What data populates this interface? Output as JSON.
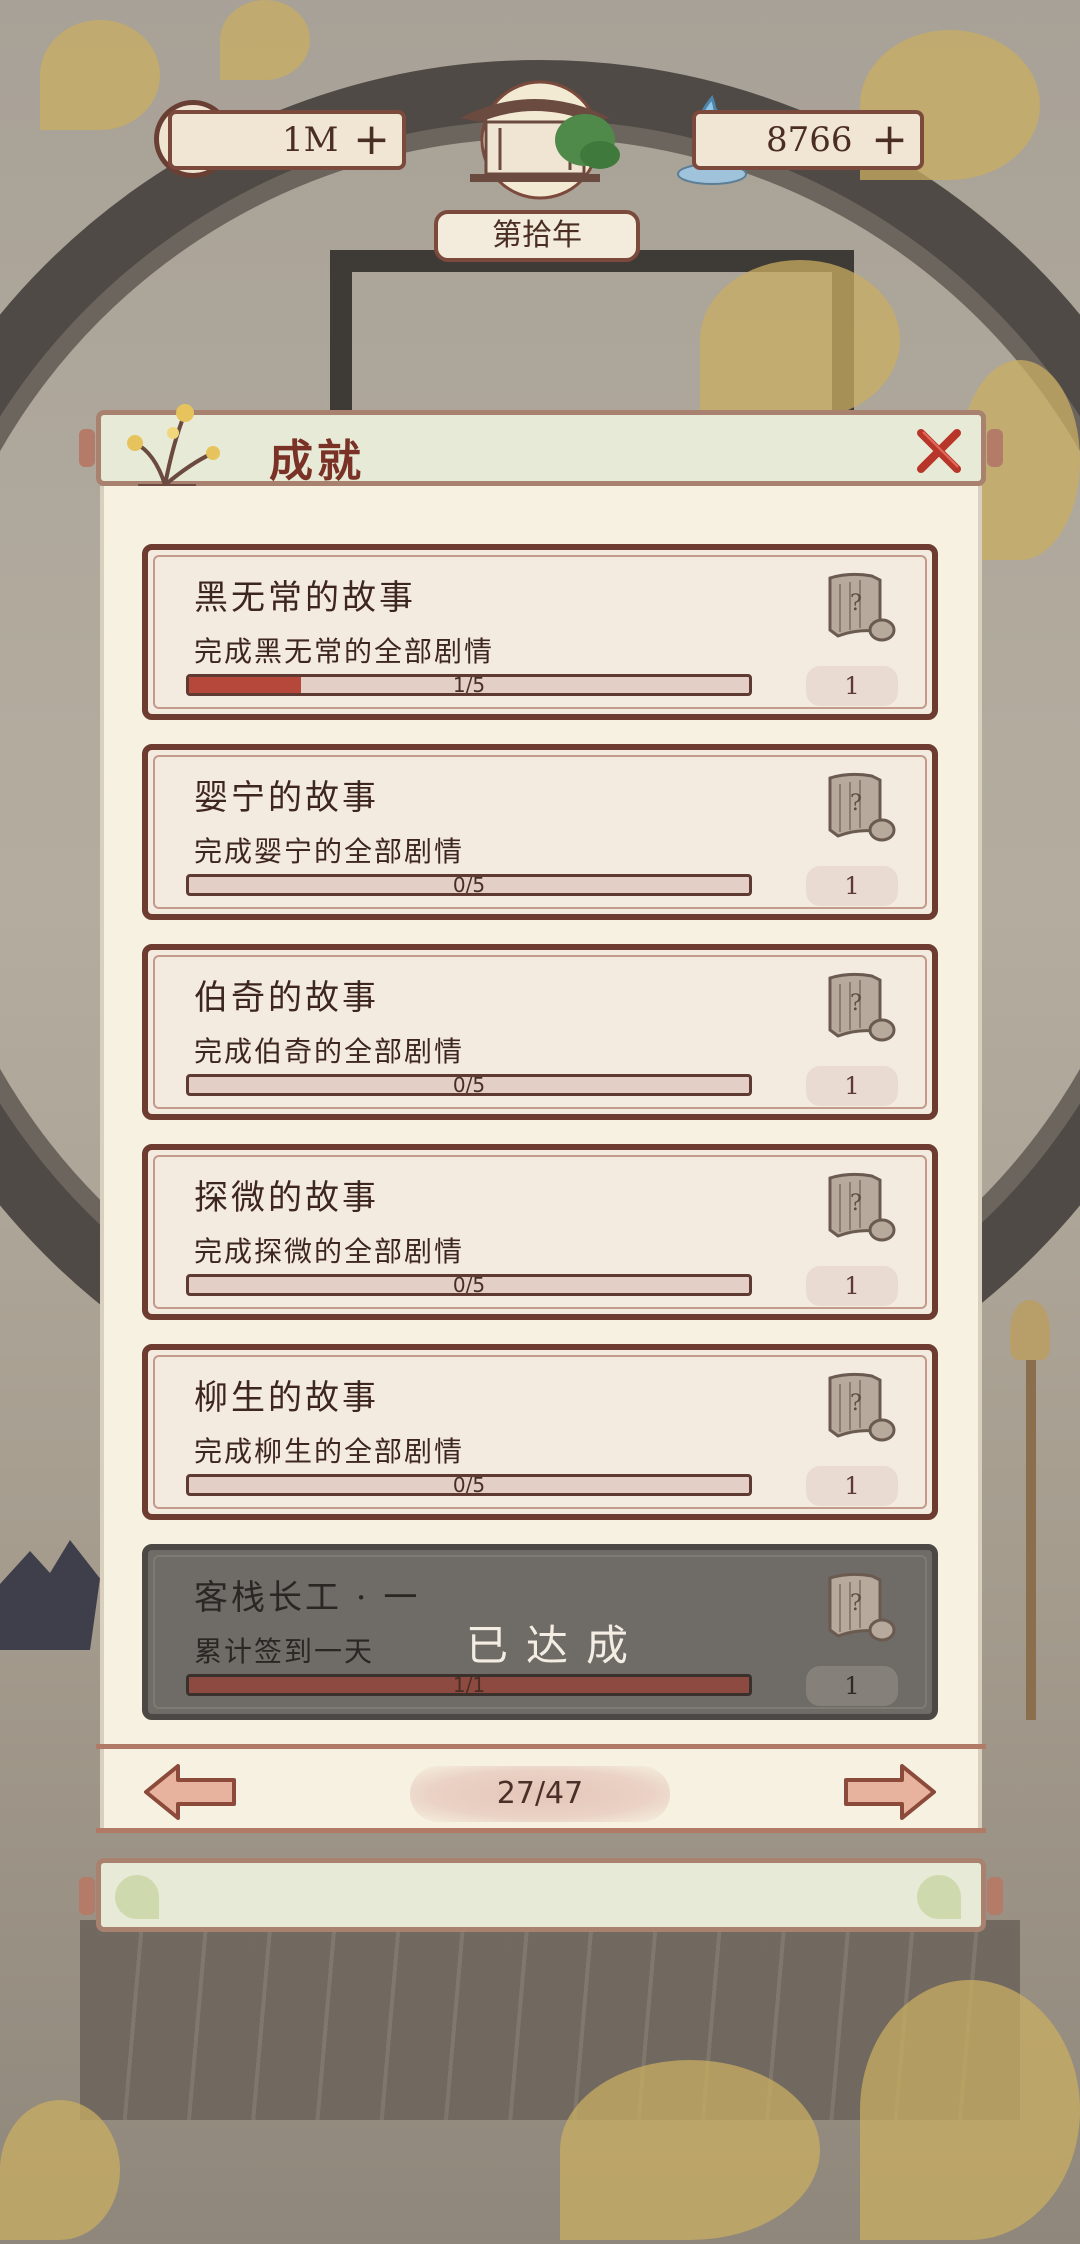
{
  "header": {
    "coins": "1M",
    "coins_plus": "+",
    "souls": "8766",
    "souls_plus": "+",
    "year": "第拾年"
  },
  "panel": {
    "title": "成就"
  },
  "achievements": [
    {
      "title": "黑无常的故事",
      "desc": "完成黑无常的全部剧情",
      "progress_text": "1/5",
      "progress": 0.2,
      "reward_qty": "1",
      "completed": false
    },
    {
      "title": "婴宁的故事",
      "desc": "完成婴宁的全部剧情",
      "progress_text": "0/5",
      "progress": 0,
      "reward_qty": "1",
      "completed": false
    },
    {
      "title": "伯奇的故事",
      "desc": "完成伯奇的全部剧情",
      "progress_text": "0/5",
      "progress": 0,
      "reward_qty": "1",
      "completed": false
    },
    {
      "title": "探微的故事",
      "desc": "完成探微的全部剧情",
      "progress_text": "0/5",
      "progress": 0,
      "reward_qty": "1",
      "completed": false
    },
    {
      "title": "柳生的故事",
      "desc": "完成柳生的全部剧情",
      "progress_text": "0/5",
      "progress": 0,
      "reward_qty": "1",
      "completed": false
    },
    {
      "title": "客栈长工 · 一",
      "desc": "累计签到一天",
      "progress_text": "1/1",
      "progress": 1,
      "reward_qty": "1",
      "completed": true,
      "completed_label": "已达成"
    }
  ],
  "pagination": {
    "page": "27/47"
  },
  "colors": {
    "accent_red": "#b5483a",
    "frame_brown": "#6d3b30",
    "panel_cream": "#f6f1e1"
  }
}
